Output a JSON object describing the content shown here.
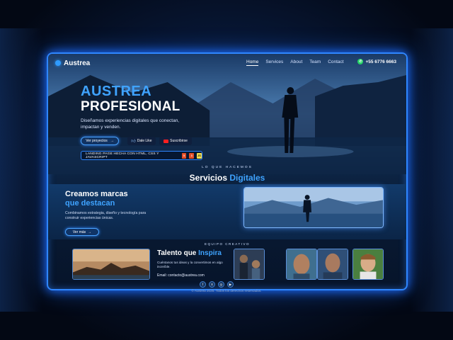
{
  "nav": {
    "brand": "Austrea",
    "links": [
      "Home",
      "Services",
      "About",
      "Team",
      "Contact"
    ],
    "phone": "+55 6776 6663"
  },
  "hero": {
    "title_line1": "AUSTREA",
    "title_line2": "PROFESIONAL",
    "subtitle": "Diseñamos experiencias digitales que conectan, impactan y venden.",
    "primary_button": "Ver proyectos",
    "like_button": "Dale Like",
    "subscribe_button": "Suscribirse",
    "tech_label": "LANDING PAGE HECHA CON HTML, CSS Y JAVASCRIPT",
    "badges": [
      "5",
      "3",
      "JS"
    ]
  },
  "services": {
    "eyebrow": "LO QUE HACEMOS",
    "title_plain": "Servicios",
    "title_accent": "Digitales",
    "band_title1": "Creamos marcas",
    "band_title2": "que destacan",
    "band_text": "Combinamos estrategia, diseño y tecnología para construir experiencias únicas.",
    "band_button": "Ver más"
  },
  "team": {
    "eyebrow": "EQUIPO CREATIVO",
    "title_plain": "Talento que",
    "title_accent": "Inspira",
    "text": "Cuéntanos tus ideas y la convertimos en algo increíble.",
    "email": "Email: contacto@austrea.com",
    "socials": [
      "f",
      "X",
      "◎",
      "▶"
    ]
  },
  "footer": "© Austrea 2025. Todos los derechos reservados.",
  "colors": {
    "accent": "#3fa3ff",
    "frame": "#2f86ff",
    "background": "#050b1c"
  }
}
